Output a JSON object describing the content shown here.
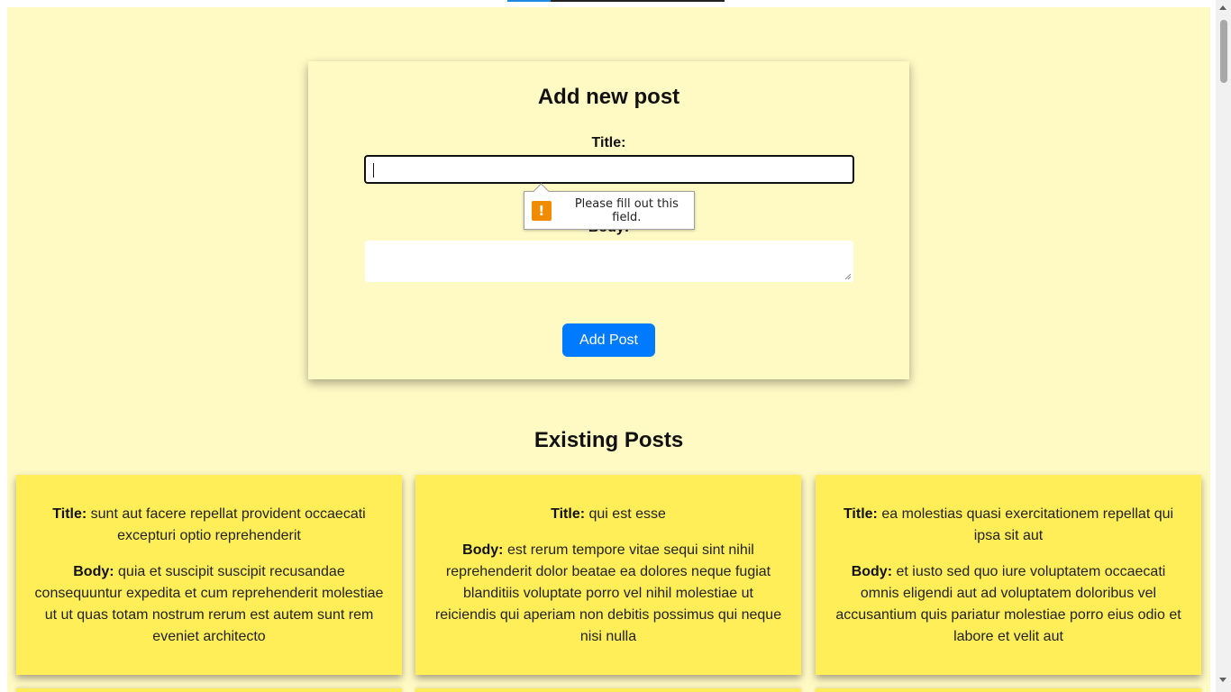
{
  "form": {
    "heading": "Add new post",
    "title_label": "Title:",
    "title_value": "",
    "body_label": "Body:",
    "body_value": "",
    "submit_label": "Add Post",
    "validation_message": "Please fill out this field.",
    "validation_icon": "warning-icon"
  },
  "posts_section": {
    "heading": "Existing Posts",
    "title_prefix": "Title:",
    "body_prefix": "Body:",
    "posts": [
      {
        "title": "sunt aut facere repellat provident occaecati excepturi optio reprehenderit",
        "body": "quia et suscipit suscipit recusandae consequuntur expedita et cum reprehenderit molestiae ut ut quas totam nostrum rerum est autem sunt rem eveniet architecto"
      },
      {
        "title": "qui est esse",
        "body": "est rerum tempore vitae sequi sint nihil reprehenderit dolor beatae ea dolores neque fugiat blanditiis voluptate porro vel nihil molestiae ut reiciendis qui aperiam non debitis possimus qui neque nisi nulla"
      },
      {
        "title": "ea molestias quasi exercitationem repellat qui ipsa sit aut",
        "body": "et iusto sed quo iure voluptatem occaecati omnis eligendi aut ad voluptatem doloribus vel accusantium quis pariatur molestiae porro eius odio et labore et velit aut"
      }
    ]
  },
  "colors": {
    "page_background": "#fff9c4",
    "card_background": "#ffee58",
    "button": "#007bff",
    "warning": "#f08c00"
  }
}
